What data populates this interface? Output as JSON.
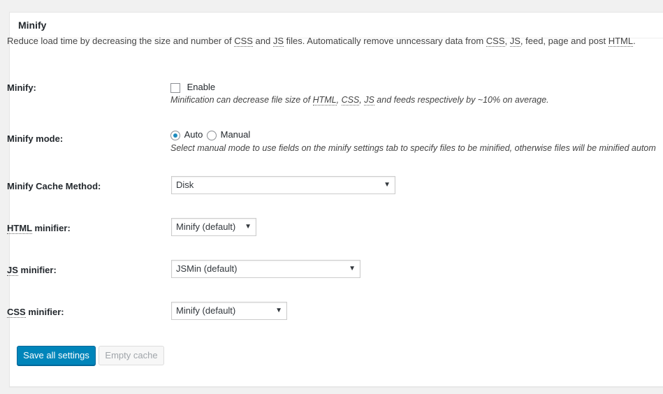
{
  "panel": {
    "title": "Minify"
  },
  "intro": {
    "p1": "Reduce load time by decreasing the size and number of ",
    "css": "CSS",
    "and": " and ",
    "js": "JS",
    "p2": " files. Automatically remove unncessary data from ",
    "css2": "CSS",
    "comma1": ", ",
    "js2": "JS",
    "p3": ", feed, page and post ",
    "html": "HTML",
    "end": "."
  },
  "minify": {
    "label": "Minify:",
    "checkbox_label": "Enable",
    "checked": false,
    "note_a": "Minification can decrease file size of ",
    "note_html": "HTML",
    "note_c1": ", ",
    "note_css": "CSS",
    "note_c2": ", ",
    "note_js": "JS",
    "note_b": " and feeds respectively by ~10% on average."
  },
  "mode": {
    "label": "Minify mode:",
    "auto_label": "Auto",
    "manual_label": "Manual",
    "selected": "Auto",
    "note": "Select manual mode to use fields on the minify settings tab to specify files to be minified, otherwise files will be minified autom"
  },
  "cache_method": {
    "label": "Minify Cache Method:",
    "value": "Disk"
  },
  "html_minifier": {
    "label_abbr": "HTML",
    "label_rest": " minifier:",
    "value": "Minify (default)"
  },
  "js_minifier": {
    "label_abbr": "JS",
    "label_rest": " minifier:",
    "value": "JSMin (default)"
  },
  "css_minifier": {
    "label_abbr": "CSS",
    "label_rest": " minifier:",
    "value": "Minify (default)"
  },
  "buttons": {
    "save": "Save all settings",
    "empty": "Empty cache"
  },
  "colors": {
    "primary": "#0085ba",
    "radio_dot": "#1e8cbe",
    "background": "#f1f1f1"
  },
  "icons": {
    "select_caret": "▼"
  }
}
